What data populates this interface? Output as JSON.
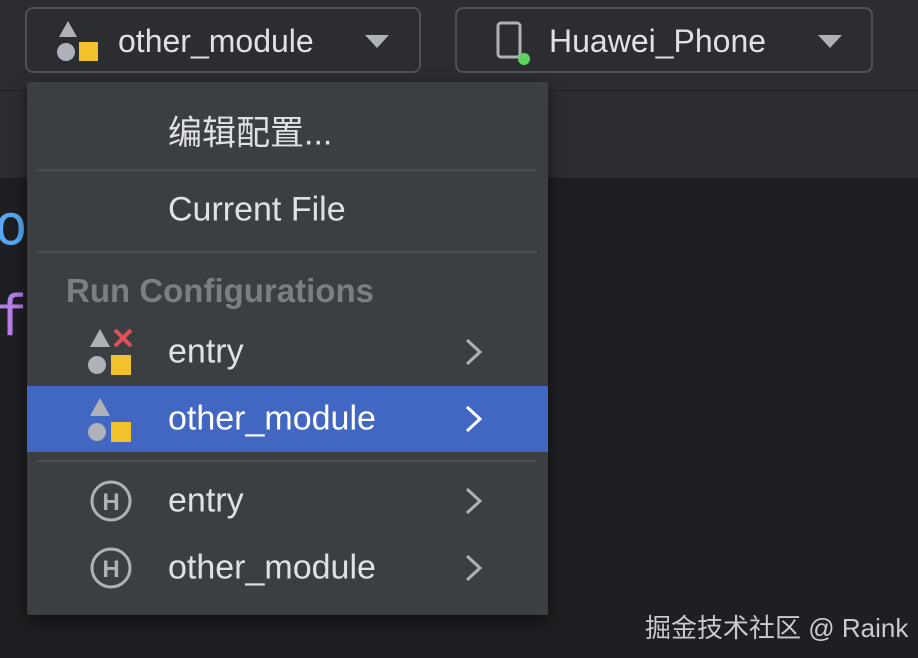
{
  "toolbar": {
    "run_config": {
      "label": "other_module",
      "icon": "module-icon"
    },
    "device": {
      "label": "Huawei_Phone",
      "icon": "phone-icon",
      "status_color": "#5fd35f"
    }
  },
  "editor": {
    "chars": [
      "o",
      "f"
    ]
  },
  "menu": {
    "edit_config": "编辑配置...",
    "current_file": "Current File",
    "section_title": "Run Configurations",
    "run_items": [
      {
        "label": "entry",
        "icon": "module-error-icon"
      },
      {
        "label": "other_module",
        "icon": "module-icon",
        "selected": true
      }
    ],
    "hvigor_items": [
      {
        "label": "entry",
        "icon": "hvigor-icon"
      },
      {
        "label": "other_module",
        "icon": "hvigor-icon"
      }
    ]
  },
  "colors": {
    "selected_row": "#4267c2",
    "popup_bg": "#3c3f41",
    "icon_yellow": "#f2c12e",
    "icon_gray": "#aeb1b7",
    "error_red": "#e0505a"
  },
  "watermark": "掘金技术社区 @ Raink"
}
